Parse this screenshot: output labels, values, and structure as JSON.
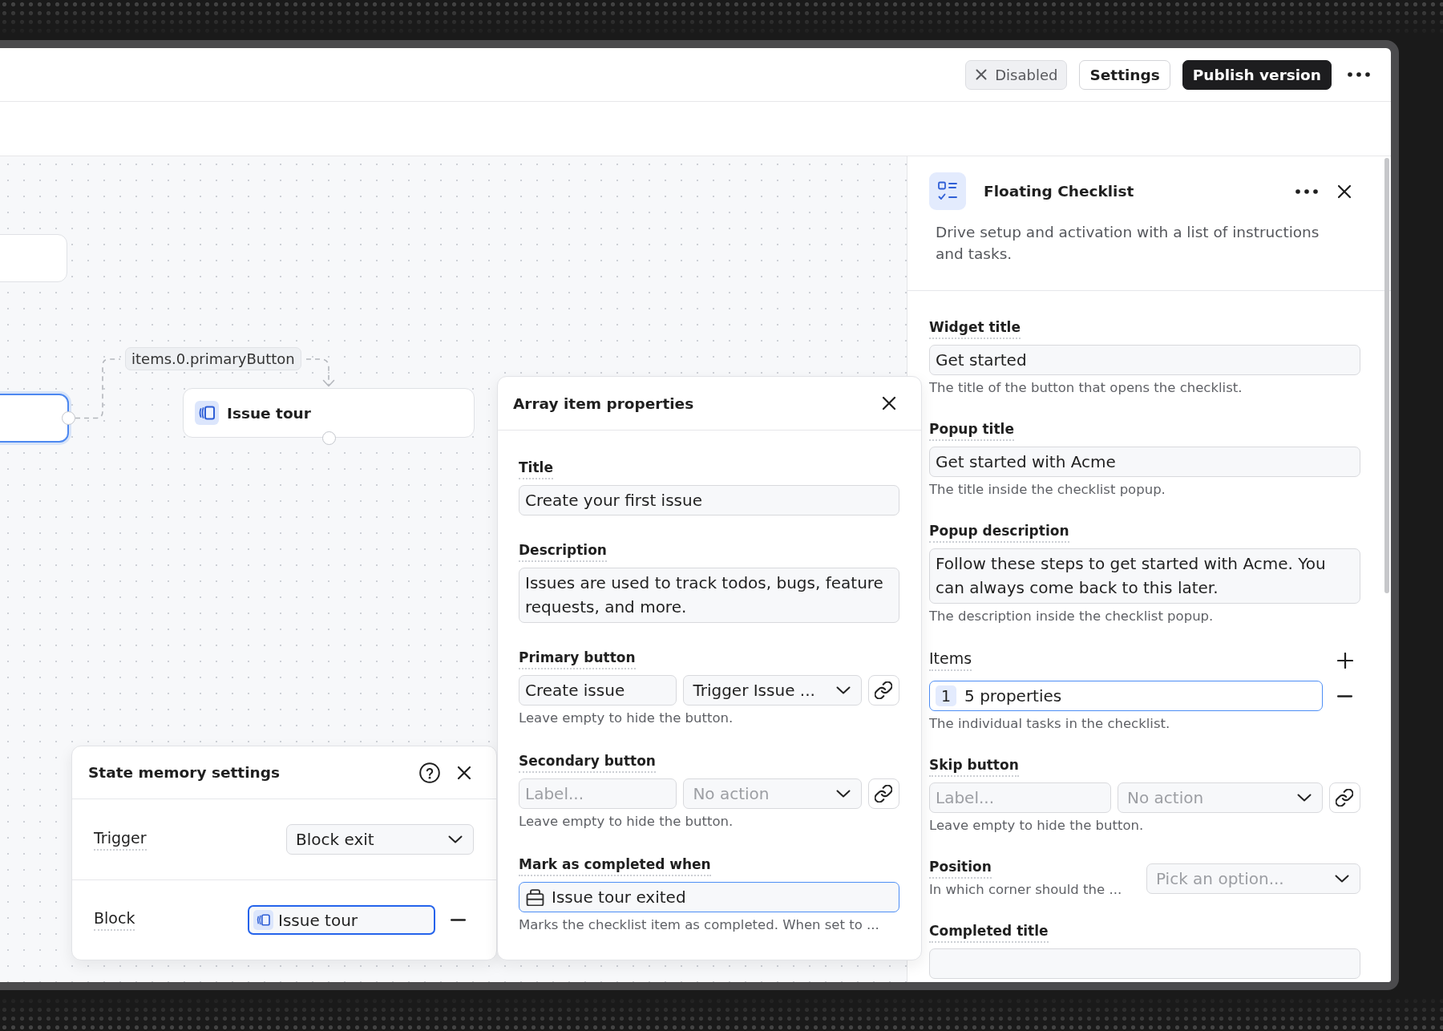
{
  "toolbar": {
    "status_toggle": {
      "label": "Disabled"
    },
    "buttons": [
      {
        "label": "Settings",
        "kind": "secondary"
      },
      {
        "label": "Publish version",
        "kind": "primary"
      }
    ]
  },
  "canvas": {
    "nodes": [
      {
        "kind": "blank",
        "selected": false
      },
      {
        "kind": "blank",
        "selected": true
      },
      {
        "kind": "tour",
        "title": "Issue tour",
        "selected": false
      }
    ],
    "edge": {
      "label": "items.0.primaryButton"
    }
  },
  "state_memory_panel": {
    "title": "State memory settings",
    "rows": [
      {
        "kind": "select",
        "label": "Trigger",
        "value": "Block exit",
        "focused": false
      },
      {
        "kind": "block",
        "label": "Block",
        "value": "Issue tour",
        "focused": true
      }
    ]
  },
  "array_item_panel": {
    "title": "Array item properties",
    "fields": [
      {
        "kind": "text",
        "label": "Title",
        "value": "Create your first issue",
        "focused": false
      },
      {
        "kind": "textarea",
        "label": "Description",
        "value": "Issues are used to track todos, bugs, feature requests, and more.",
        "focused": false
      },
      {
        "kind": "button",
        "label": "Primary button",
        "value": "Create issue",
        "focused": false,
        "action": {
          "value": "Trigger Issue ..."
        },
        "help": "Leave empty to hide the button."
      },
      {
        "kind": "button",
        "label": "Secondary button",
        "placeholder": "Label...",
        "focused": false,
        "action": {
          "placeholder": "No action"
        },
        "help": "Leave empty to hide the button."
      },
      {
        "kind": "event",
        "label": "Mark as completed when",
        "value": "Issue tour exited",
        "focused": true,
        "help": "Marks the checklist item as completed. When set to ..."
      }
    ]
  },
  "properties_panel": {
    "title": "Floating Checklist",
    "description": "Drive setup and activation with a list of instructions and tasks.",
    "fields": [
      {
        "kind": "text",
        "label": "Widget title",
        "value": "Get started",
        "focused": false,
        "help": "The title of the button that opens the checklist."
      },
      {
        "kind": "text",
        "label": "Popup title",
        "value": "Get started with Acme",
        "focused": false,
        "help": "The title inside the checklist popup."
      },
      {
        "kind": "textarea",
        "label": "Popup description",
        "value": "Follow these steps to get started with Acme. You can always come back to this later.",
        "focused": false,
        "help": "The description inside the checklist popup."
      },
      {
        "kind": "array",
        "label": "Items",
        "entries": [
          {
            "index": "1",
            "summary": "5 properties",
            "selected": true
          }
        ],
        "help": "The individual tasks in the checklist."
      },
      {
        "kind": "button",
        "label": "Skip button",
        "placeholder": "Label...",
        "focused": false,
        "action": {
          "placeholder": "No action"
        },
        "help": "Leave empty to hide the button."
      },
      {
        "kind": "inline_select",
        "label": "Position",
        "help": "In which corner should the ...",
        "select": {
          "placeholder": "Pick an option..."
        }
      },
      {
        "kind": "text",
        "label": "Completed title",
        "focused": false
      }
    ]
  }
}
